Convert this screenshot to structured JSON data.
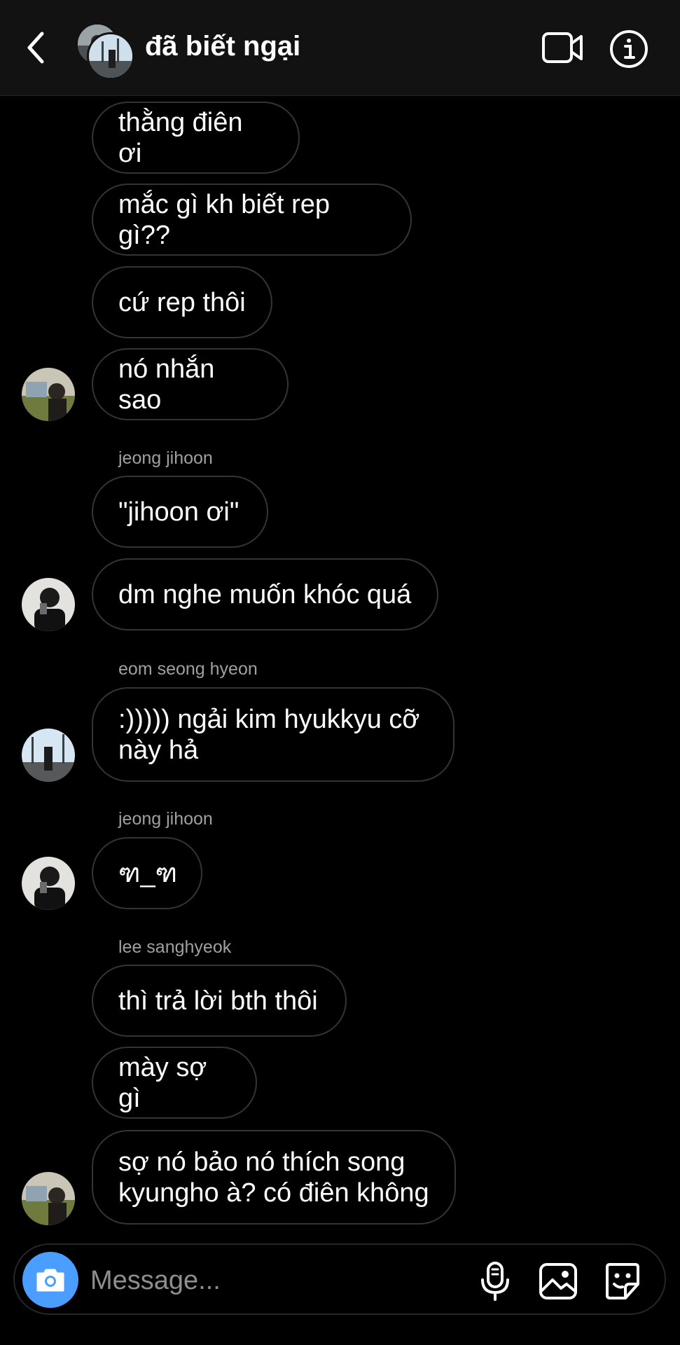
{
  "header": {
    "title": "đã biết ngại",
    "back_icon": "chevron-left-icon",
    "video_icon": "video-camera-icon",
    "info_icon": "info-icon"
  },
  "messages": [
    {
      "text": "thằng điên ơi"
    },
    {
      "text": "mắc gì kh biết rep gì??"
    },
    {
      "text": "cứ rep thôi"
    },
    {
      "text": "nó nhắn sao"
    },
    {
      "sender": "jeong jihoon",
      "text": "\"jihoon ơi\""
    },
    {
      "text": "dm nghe muốn khóc quá"
    },
    {
      "sender": "eom seong hyeon",
      "text": ":))))) ngải kim hyukkyu cỡ\nnày hả"
    },
    {
      "sender": "jeong jihoon",
      "text": "ฑ_ฑ"
    },
    {
      "sender": "lee sanghyeok",
      "text": "thì trả lời bth thôi"
    },
    {
      "text": "mày sợ gì"
    },
    {
      "text": "sợ nó bảo nó thích song\nkyungho à? có điên không"
    }
  ],
  "composer": {
    "placeholder": "Message...",
    "camera_icon": "camera-icon",
    "mic_icon": "microphone-icon",
    "gallery_icon": "image-icon",
    "sticker_icon": "sticker-icon"
  },
  "colors": {
    "background": "#000000",
    "header": "#121212",
    "bubble_border": "#343434",
    "camera_button": "#4a9eff",
    "sender_text": "#a0a0a0"
  }
}
